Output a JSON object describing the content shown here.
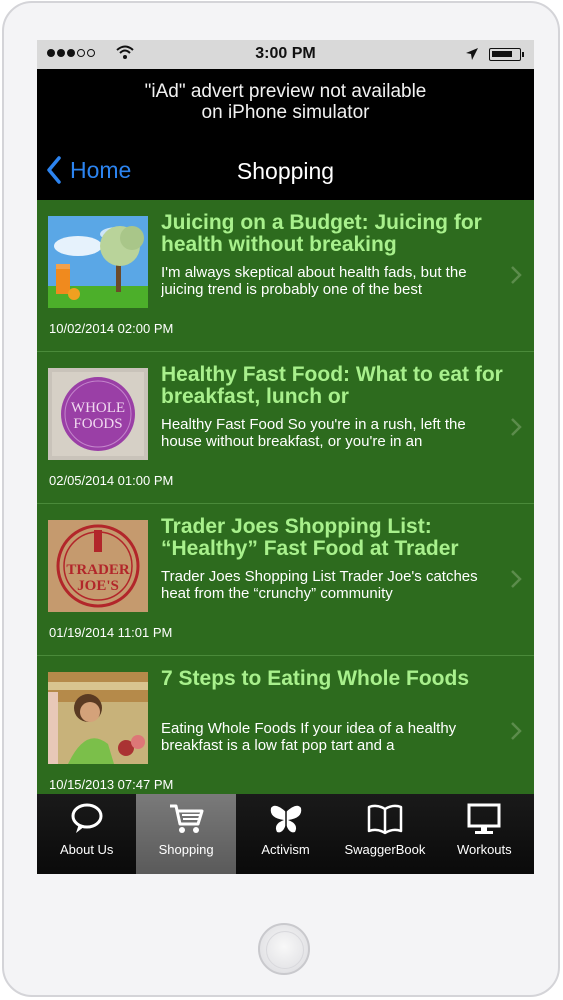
{
  "status_bar": {
    "time": "3:00 PM"
  },
  "ad_banner": {
    "line1": "\"iAd\" advert preview not available",
    "line2": "on iPhone simulator"
  },
  "nav": {
    "back_label": "Home",
    "title": "Shopping"
  },
  "articles": [
    {
      "title": "Juicing on a Budget: Juicing for health without breaking",
      "excerpt": "I'm always skeptical about health fads, but the juicing trend is probably one of the best",
      "date": "10/02/2014 02:00 PM",
      "thumb_icon": "money-tree-juice-image"
    },
    {
      "title": "Healthy Fast Food: What to eat for breakfast, lunch or",
      "excerpt": "Healthy Fast Food So you're in a rush, left the house without breakfast, or you're in an",
      "date": "02/05/2014 01:00 PM",
      "thumb_icon": "whole-foods-logo-image",
      "thumb_text": [
        "WHOLE",
        "FOODS"
      ]
    },
    {
      "title": "Trader Joes Shopping List: “Healthy” Fast Food at Trader",
      "excerpt": "Trader Joes Shopping List Trader Joe's catches heat from the “crunchy” community",
      "date": "01/19/2014 11:01 PM",
      "thumb_icon": "trader-joes-logo-image",
      "thumb_text": [
        "TRADER",
        "JOE'S"
      ]
    },
    {
      "title": "7 Steps to Eating Whole Foods",
      "excerpt": "Eating Whole Foods If your idea of a healthy breakfast is a low fat pop tart and a",
      "date": "10/15/2013 07:47 PM",
      "thumb_icon": "child-grocery-photo-image"
    }
  ],
  "tabs": [
    {
      "label": "About Us",
      "icon": "speech-bubble-icon",
      "active": false
    },
    {
      "label": "Shopping",
      "icon": "shopping-cart-icon",
      "active": true
    },
    {
      "label": "Activism",
      "icon": "butterfly-icon",
      "active": false
    },
    {
      "label": "SwaggerBook",
      "icon": "open-book-icon",
      "active": false
    },
    {
      "label": "Workouts",
      "icon": "monitor-icon",
      "active": false
    }
  ],
  "colors": {
    "list_background": "#2d6b1e",
    "title_green": "#a8f08c",
    "back_blue": "#2c84f0",
    "active_tab": "#6a6a6a"
  }
}
